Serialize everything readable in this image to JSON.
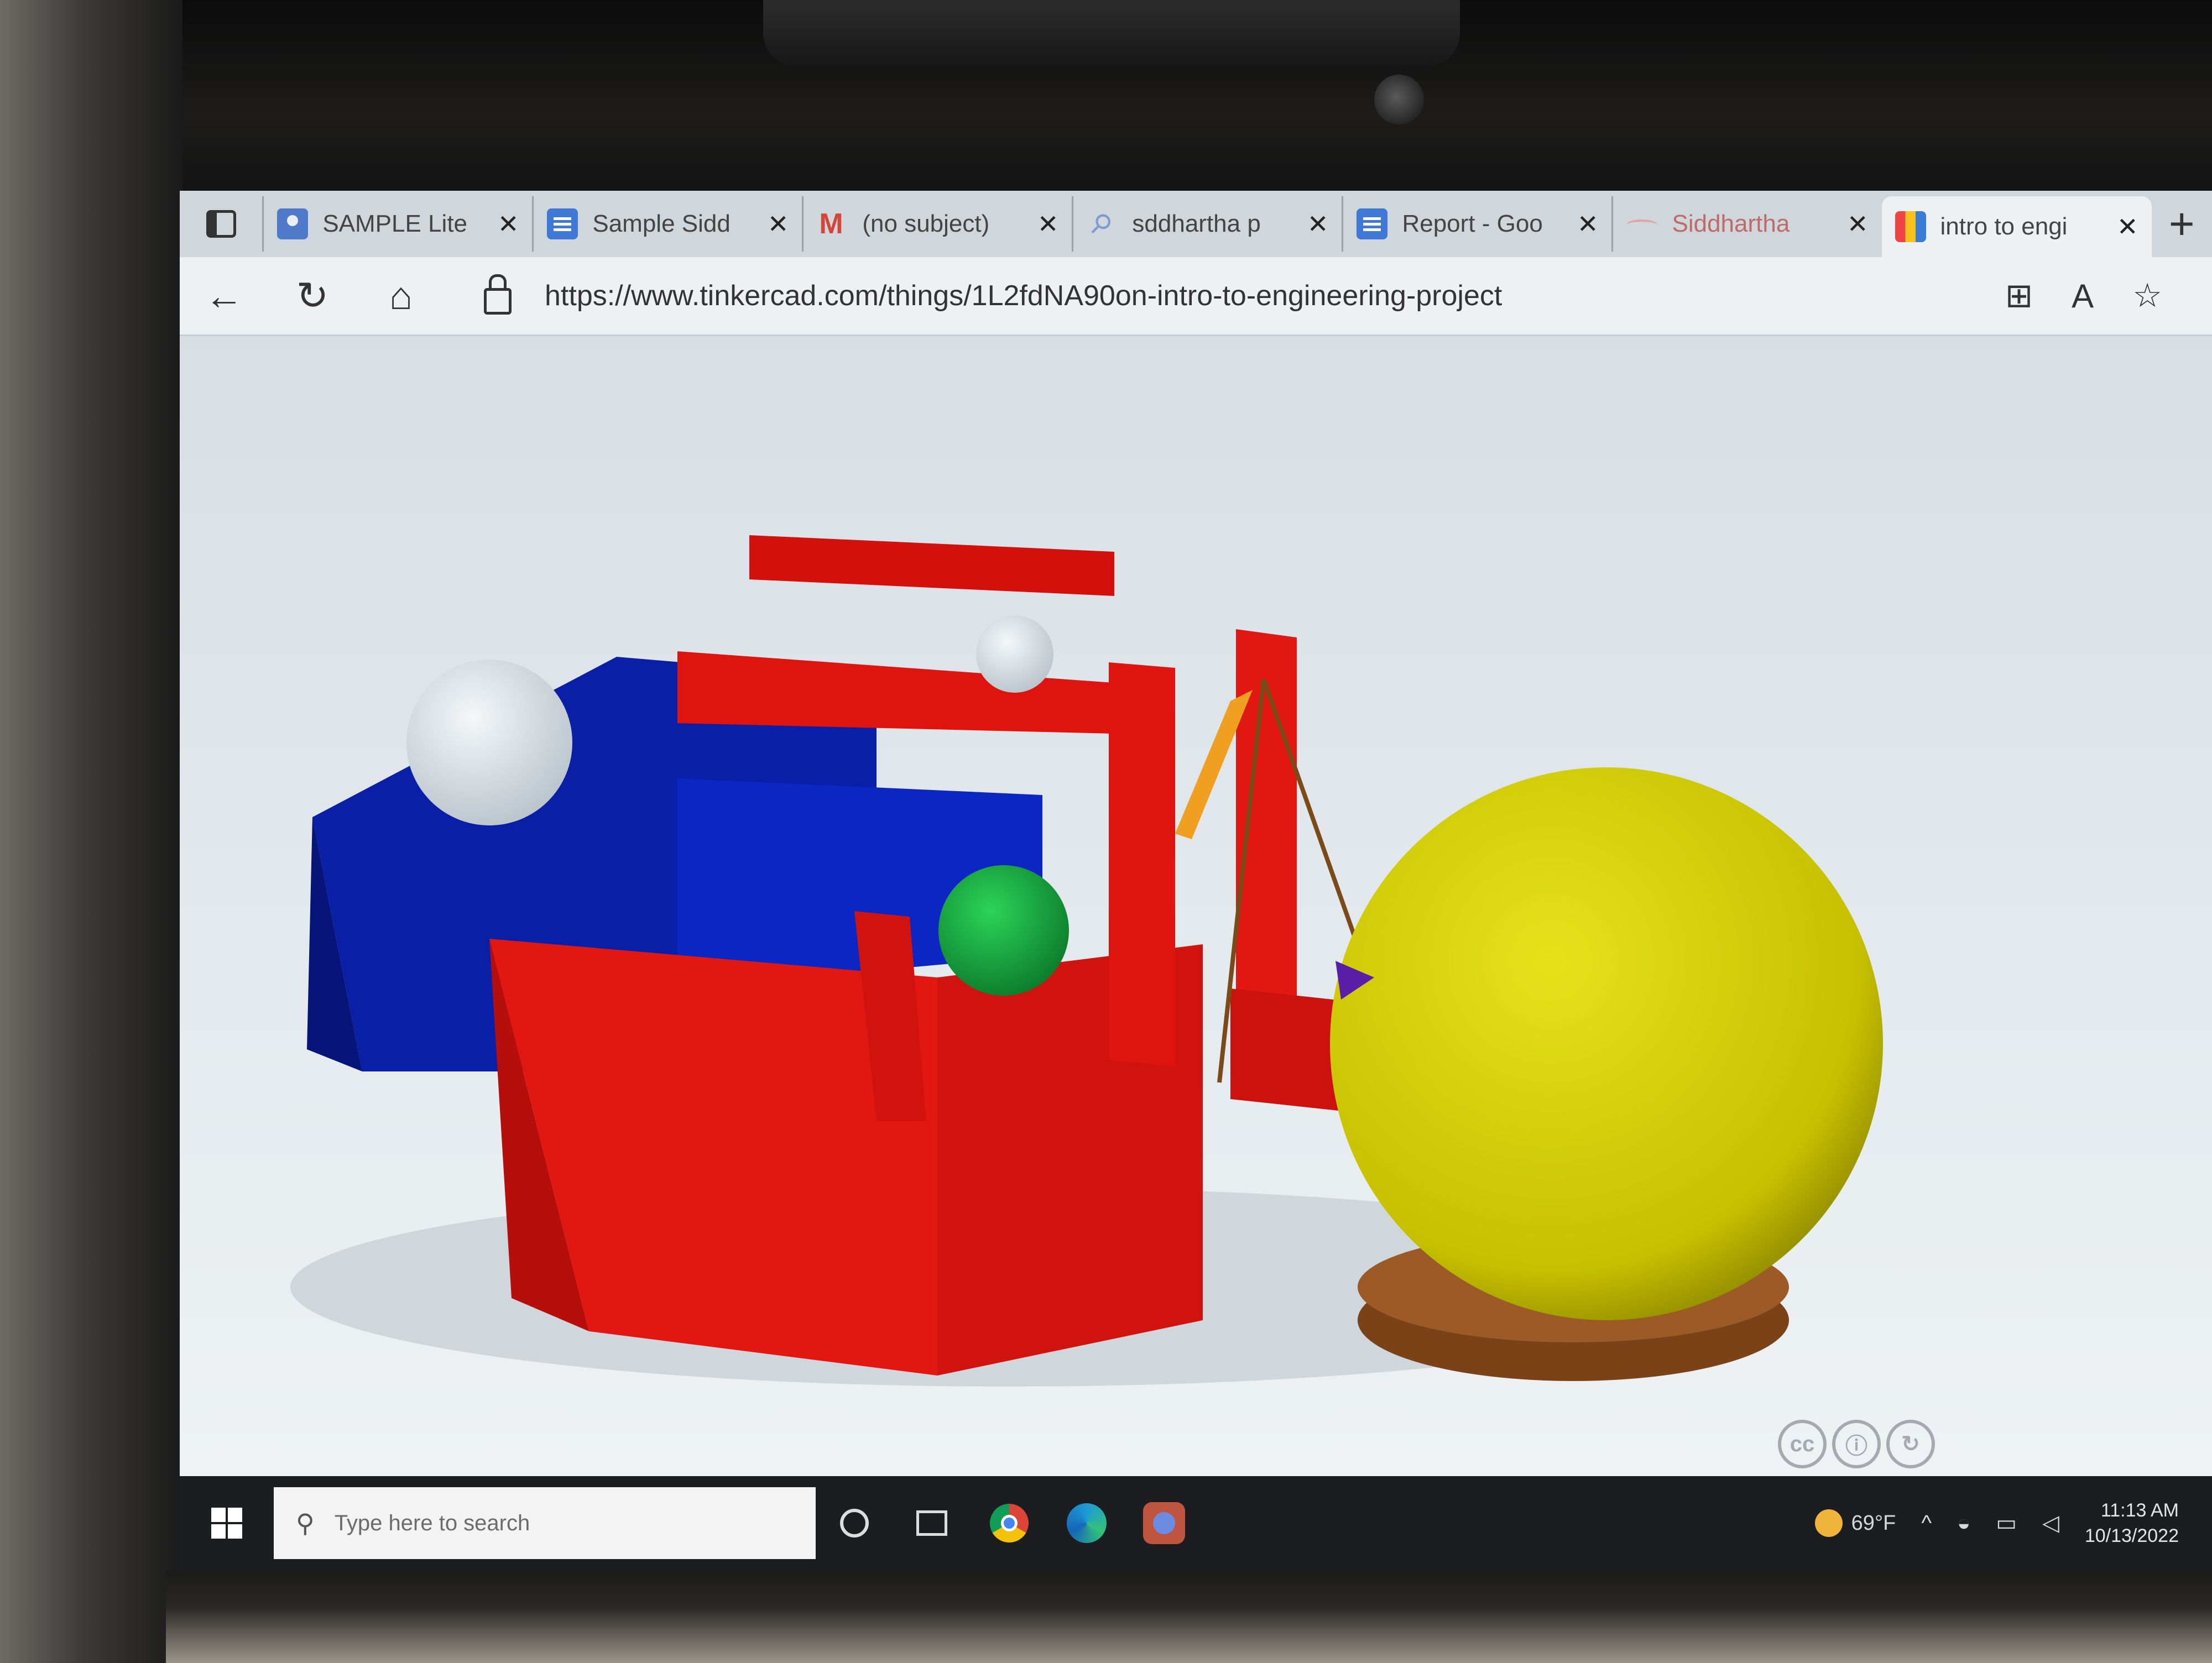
{
  "browser": {
    "tabs": [
      {
        "title": "SAMPLE Lite",
        "icon": "contacts-icon",
        "active": false
      },
      {
        "title": "Sample Sidd",
        "icon": "docs-icon",
        "active": false
      },
      {
        "title": "(no subject)",
        "icon": "gmail-icon",
        "active": false
      },
      {
        "title": "sddhartha p",
        "icon": "search-icon",
        "active": false
      },
      {
        "title": "Report - Goo",
        "icon": "docs-icon",
        "active": false
      },
      {
        "title": "Siddhartha",
        "icon": "sheet-icon",
        "active": false
      },
      {
        "title": "intro to engi",
        "icon": "tinkercad-icon",
        "active": true
      }
    ],
    "tab_close_glyph": "✕",
    "new_tab_glyph": "+",
    "url": "https://www.tinkercad.com/things/1L2fdNA90on-intro-to-engineering-project",
    "nav": {
      "back_glyph": "←",
      "reload_glyph": "↻",
      "home_glyph": "⌂"
    },
    "toolbar_icons": {
      "split_screen": "⊞",
      "read_aloud": "A",
      "favorites": "☆"
    }
  },
  "viewer": {
    "license_badges": [
      "cc",
      "ⓘ",
      "↻"
    ],
    "colors": {
      "red": "#e0140f",
      "blue": "#0a1fa8",
      "yellow": "#d6d10a",
      "green": "#17a83c",
      "white": "#e6ecf0",
      "brown": "#8a4a1c"
    }
  },
  "taskbar": {
    "search_placeholder": "Type here to search",
    "weather_temp": "69°F",
    "time": "11:13 AM",
    "date": "10/13/2022"
  }
}
